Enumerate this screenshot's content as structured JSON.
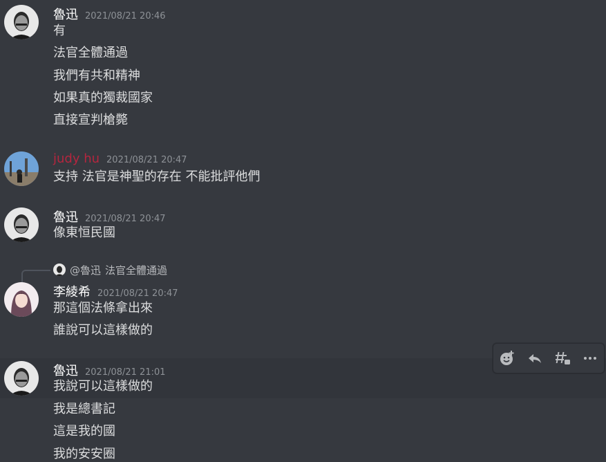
{
  "messages": [
    {
      "author": "魯迅",
      "timestamp": "2021/08/21 20:46",
      "lines": [
        "有",
        "法官全體通過",
        "我們有共和精神",
        "如果真的獨裁國家",
        "直接宣判槍斃"
      ]
    },
    {
      "author": "judy hu",
      "author_color": "#b5263f",
      "timestamp": "2021/08/21 20:47",
      "lines": [
        "支持 法官是神聖的存在 不能批評他們"
      ]
    },
    {
      "author": "魯迅",
      "timestamp": "2021/08/21 20:47",
      "lines": [
        "像東恒民國"
      ]
    },
    {
      "reply": {
        "author": "@魯迅",
        "text": "法官全體通過"
      },
      "author": "李綾希",
      "timestamp": "2021/08/21 20:47",
      "lines": [
        "那這個法條拿出來",
        "誰說可以這樣做的"
      ]
    },
    {
      "author": "魯迅",
      "timestamp": "2021/08/21 21:01",
      "lines": [
        "我說可以這樣做的",
        "我是總書記",
        "這是我的國",
        "我的安安圈"
      ]
    }
  ],
  "toolbar": {
    "icons": [
      "add-reaction-icon",
      "reply-icon",
      "create-thread-icon",
      "more-options-icon"
    ]
  },
  "colors": {
    "background": "#36393f",
    "hover_background": "#32353b",
    "text": "#dcddde",
    "timestamp": "#8e9297",
    "username": "#ffffff",
    "judy_username": "#b5263f"
  }
}
